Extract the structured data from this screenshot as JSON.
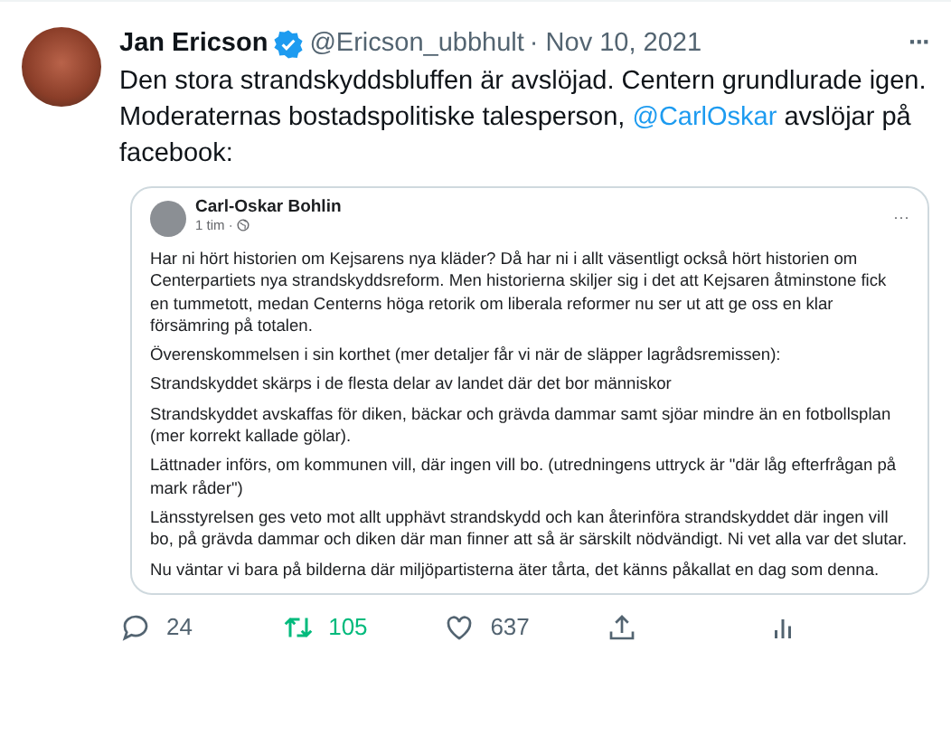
{
  "tweet": {
    "author": {
      "name": "Jan Ericson",
      "verified": true,
      "handle": "@Ericson_ubbhult",
      "date": "· Nov 10, 2021"
    },
    "text_before": "Den stora strandskyddsbluffen är avslöjad. Centern grundlurade igen. Moderaternas bostadspolitiske talesperson, ",
    "mention": "@CarlOskar",
    "text_after": " avslöjar på facebook:",
    "more": "···",
    "embedded_post": {
      "author": "Carl-Oskar Bohlin",
      "time": "1 tim ·",
      "more": "···",
      "paragraphs": [
        "Har ni hört historien om Kejsarens nya kläder? Då har ni i allt väsentligt också hört historien om Centerpartiets nya strandskyddsreform. Men historierna skiljer sig i det att Kejsaren åtminstone fick en tummetott, medan Centerns höga retorik om liberala reformer nu ser ut att ge oss en klar försämring på totalen.",
        "Överenskommelsen i sin korthet (mer detaljer får vi när de släpper lagrådsremissen):",
        "Strandskyddet skärps i de flesta delar av landet där det bor människor",
        "Strandskyddet avskaffas för diken, bäckar och grävda dammar samt sjöar mindre än en fotbollsplan (mer korrekt kallade gölar).",
        "Lättnader införs, om kommunen vill, där ingen vill bo. (utredningens uttryck är \"där låg efterfrågan på mark råder\")",
        "Länsstyrelsen ges veto mot allt upphävt strandskydd och kan återinföra strandskyddet där ingen vill bo, på grävda dammar och diken där man finner att så är särskilt nödvändigt. Ni vet alla var det slutar.",
        "Nu väntar vi bara på bilderna där miljöpartisterna äter tårta, det känns påkallat en dag som denna."
      ]
    },
    "actions": [
      {
        "kind": "reply",
        "count": "24",
        "active": false
      },
      {
        "kind": "retweet",
        "count": "105",
        "active": true
      },
      {
        "kind": "like",
        "count": "637",
        "active": false
      },
      {
        "kind": "share",
        "active": false
      },
      {
        "kind": "analytics",
        "active": false
      }
    ]
  }
}
